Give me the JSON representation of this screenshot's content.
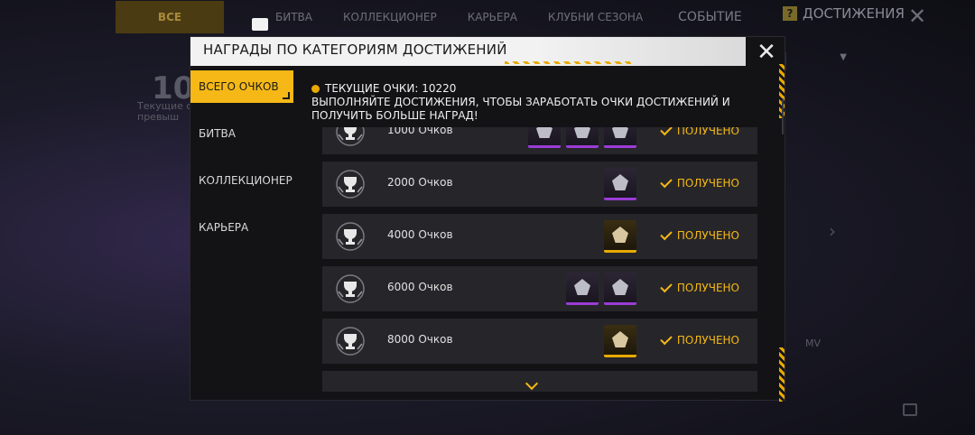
{
  "background": {
    "tabs": [
      "ВСЕ",
      "БИТВА",
      "КОЛЛЕКЦИОНЕР",
      "КАРЬЕРА",
      "КЛУБНИ СЕЗОНА"
    ],
    "event_tab": "СОБЫТИЕ",
    "achievements_label": "ДОСТИЖЕНИЯ",
    "big_number": "10",
    "current_label_1": "Текущие о",
    "current_label_2": "превыш",
    "mvp_label": "MV"
  },
  "modal": {
    "title": "НАГРАДЫ ПО КАТЕГОРИЯМ ДОСТИЖЕНИЙ",
    "sidebar": [
      {
        "label": "ВСЕГО ОЧКОВ",
        "active": true
      },
      {
        "label": "БИТВА",
        "active": false
      },
      {
        "label": "КОЛЛЕКЦИОНЕР",
        "active": false
      },
      {
        "label": "КАРЬЕРА",
        "active": false
      }
    ],
    "current_points": "ТЕКУЩИЕ ОЧКИ: 10220",
    "description_1": "ВЫПОЛНЯЙТЕ ДОСТИЖЕНИЯ, ЧТОБЫ ЗАРАБОТАТЬ ОЧКИ ДОСТИЖЕНИЙ И",
    "description_2": "ПОЛУЧИТЬ БОЛЬШЕ НАГРАД!",
    "rows": [
      {
        "points": "1000 Очков",
        "items": [
          "purple",
          "purple",
          "purple"
        ],
        "status": "ПОЛУЧЕНО"
      },
      {
        "points": "2000 Очков",
        "items": [
          "purple"
        ],
        "status": "ПОЛУЧЕНО"
      },
      {
        "points": "4000 Очков",
        "items": [
          "gold"
        ],
        "status": "ПОЛУЧЕНО"
      },
      {
        "points": "6000 Очков",
        "items": [
          "purple",
          "purple"
        ],
        "status": "ПОЛУЧЕНО"
      },
      {
        "points": "8000 Очков",
        "items": [
          "gold"
        ],
        "status": "ПОЛУЧЕНО"
      }
    ]
  },
  "colors": {
    "accent": "#f5b816",
    "purple_rarity": "#9b3cd6",
    "gold_rarity": "#e8a900"
  }
}
